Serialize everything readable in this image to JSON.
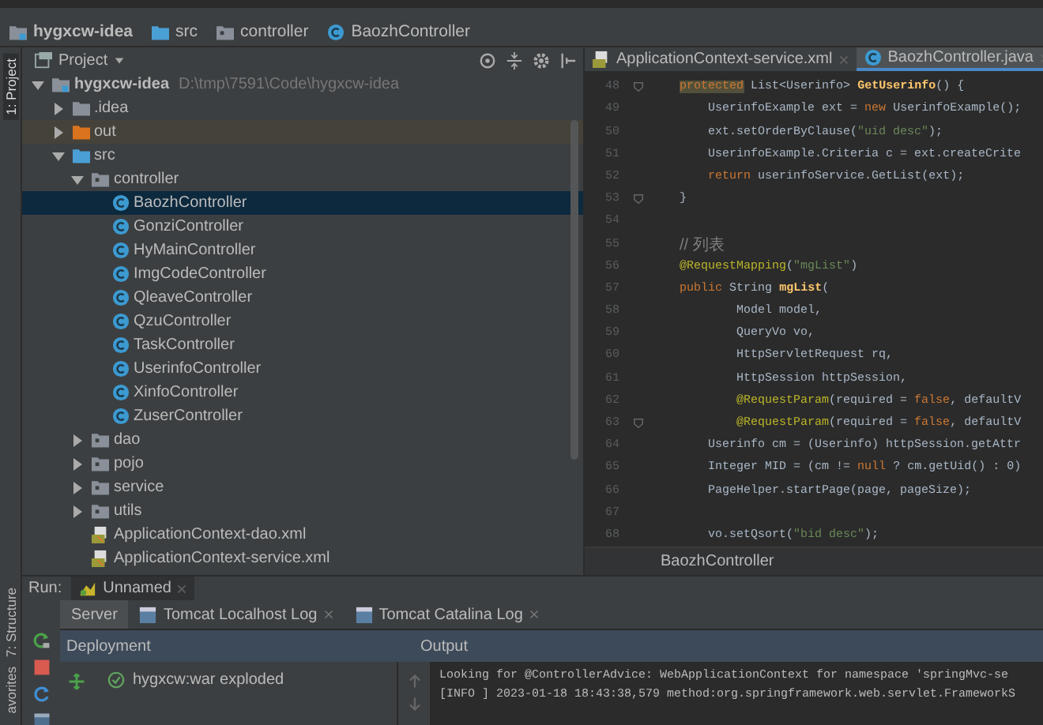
{
  "breadcrumbs": [
    {
      "label": "hygxcw-idea",
      "kind": "module"
    },
    {
      "label": "src",
      "kind": "folder"
    },
    {
      "label": "controller",
      "kind": "package"
    },
    {
      "label": "BaozhController",
      "kind": "class"
    }
  ],
  "tool_strip": {
    "top": [
      {
        "label": "1: Project",
        "selected": true
      }
    ],
    "bottom": [
      {
        "label": "7: Structure",
        "selected": false
      },
      {
        "label": "avorites",
        "selected": false
      }
    ]
  },
  "project": {
    "title": "Project",
    "tree": [
      {
        "label": "hygxcw-idea",
        "path": "D:\\tmp\\7591\\Code\\hygxcw-idea",
        "kind": "module",
        "expanded": true,
        "selected": false,
        "children": [
          {
            "label": ".idea",
            "kind": "folder",
            "expanded": false,
            "selected": false
          },
          {
            "label": "out",
            "kind": "excluded",
            "expanded": false,
            "selected": false
          },
          {
            "label": "src",
            "kind": "source",
            "expanded": true,
            "selected": false,
            "children": [
              {
                "label": "controller",
                "kind": "package",
                "expanded": true,
                "selected": false,
                "children": [
                  {
                    "label": "BaozhController",
                    "kind": "class",
                    "selected": true
                  },
                  {
                    "label": "GonziController",
                    "kind": "class",
                    "selected": false
                  },
                  {
                    "label": "HyMainController",
                    "kind": "class",
                    "selected": false
                  },
                  {
                    "label": "ImgCodeController",
                    "kind": "class",
                    "selected": false
                  },
                  {
                    "label": "QleaveController",
                    "kind": "class",
                    "selected": false
                  },
                  {
                    "label": "QzuController",
                    "kind": "class",
                    "selected": false
                  },
                  {
                    "label": "TaskController",
                    "kind": "class",
                    "selected": false
                  },
                  {
                    "label": "UserinfoController",
                    "kind": "class",
                    "selected": false
                  },
                  {
                    "label": "XinfoController",
                    "kind": "class",
                    "selected": false
                  },
                  {
                    "label": "ZuserController",
                    "kind": "class",
                    "selected": false
                  }
                ]
              },
              {
                "label": "dao",
                "kind": "package",
                "expanded": false,
                "selected": false
              },
              {
                "label": "pojo",
                "kind": "package",
                "expanded": false,
                "selected": false
              },
              {
                "label": "service",
                "kind": "package",
                "expanded": false,
                "selected": false
              },
              {
                "label": "utils",
                "kind": "package",
                "expanded": false,
                "selected": false
              },
              {
                "label": "ApplicationContext-dao.xml",
                "kind": "xml",
                "selected": false
              },
              {
                "label": "ApplicationContext-service.xml",
                "kind": "xml",
                "selected": false
              }
            ]
          }
        ]
      }
    ]
  },
  "editor": {
    "tabs": [
      {
        "label": "ApplicationContext-service.xml",
        "kind": "xml",
        "selected": false
      },
      {
        "label": "BaozhController.java",
        "kind": "class",
        "selected": true
      }
    ],
    "lines": [
      {
        "number": "48",
        "fold": true,
        "segments": [
          {
            "t": "    protected",
            "kind": "keyword-marked"
          },
          {
            "t": " List<Userinfo> "
          },
          {
            "t": "GetUserinfo",
            "kind": "method"
          },
          {
            "t": "() {"
          }
        ]
      },
      {
        "number": "49",
        "fold": false,
        "segments": [
          {
            "t": "        UserinfoExample ext = "
          },
          {
            "t": "new",
            "kind": "keyword"
          },
          {
            "t": " UserinfoExample();"
          }
        ]
      },
      {
        "number": "50",
        "fold": false,
        "segments": [
          {
            "t": "        ext.setOrderByClause("
          },
          {
            "t": "\"uid desc\"",
            "kind": "string"
          },
          {
            "t": ");"
          }
        ]
      },
      {
        "number": "51",
        "fold": false,
        "segments": [
          {
            "t": "        UserinfoExample.Criteria c = ext.createCrite"
          }
        ]
      },
      {
        "number": "52",
        "fold": false,
        "segments": [
          {
            "t": "        return",
            "kind": "keyword"
          },
          {
            "t": " userinfoService.GetList(ext);"
          }
        ]
      },
      {
        "number": "53",
        "fold": true,
        "segments": [
          {
            "t": "    }"
          }
        ]
      },
      {
        "number": "54",
        "fold": false
      },
      {
        "number": "55",
        "fold": false,
        "segments": [
          {
            "t": "    // 列表",
            "kind": "comment"
          }
        ]
      },
      {
        "number": "56",
        "fold": false,
        "segments": [
          {
            "t": "    @RequestMapping",
            "kind": "annotation"
          },
          {
            "t": "("
          },
          {
            "t": "\"mgList\"",
            "kind": "string"
          },
          {
            "t": ")"
          }
        ]
      },
      {
        "number": "57",
        "fold": false,
        "segments": [
          {
            "t": "    public",
            "kind": "keyword"
          },
          {
            "t": " String "
          },
          {
            "t": "mgList",
            "kind": "method"
          },
          {
            "t": "("
          }
        ]
      },
      {
        "number": "58",
        "fold": false,
        "segments": [
          {
            "t": "            Model model,"
          }
        ]
      },
      {
        "number": "59",
        "fold": false,
        "segments": [
          {
            "t": "            QueryVo vo,"
          }
        ]
      },
      {
        "number": "60",
        "fold": false,
        "segments": [
          {
            "t": "            HttpServletRequest rq,"
          }
        ]
      },
      {
        "number": "61",
        "fold": false,
        "segments": [
          {
            "t": "            HttpSession httpSession,"
          }
        ]
      },
      {
        "number": "62",
        "fold": false,
        "segments": [
          {
            "t": "            @RequestParam",
            "kind": "annotation"
          },
          {
            "t": "(required = "
          },
          {
            "t": "false",
            "kind": "keyword"
          },
          {
            "t": ", defaultV"
          }
        ]
      },
      {
        "number": "63",
        "fold": true,
        "segments": [
          {
            "t": "            @RequestParam",
            "kind": "annotation"
          },
          {
            "t": "(required = "
          },
          {
            "t": "false",
            "kind": "keyword"
          },
          {
            "t": ", defaultV"
          }
        ]
      },
      {
        "number": "64",
        "fold": false,
        "segments": [
          {
            "t": "        Userinfo cm = (Userinfo) httpSession.getAttr"
          }
        ]
      },
      {
        "number": "65",
        "fold": false,
        "segments": [
          {
            "t": "        Integer MID = (cm != "
          },
          {
            "t": "null",
            "kind": "keyword"
          },
          {
            "t": " ? cm.getUid() : 0)"
          }
        ]
      },
      {
        "number": "66",
        "fold": false,
        "segments": [
          {
            "t": "        PageHelper.startPage(page, pageSize);"
          }
        ]
      },
      {
        "number": "67",
        "fold": false
      },
      {
        "number": "68",
        "fold": false,
        "segments": [
          {
            "t": "        vo.setQsort("
          },
          {
            "t": "\"bid desc\"",
            "kind": "string"
          },
          {
            "t": ");"
          }
        ]
      }
    ],
    "breadcrumb": "BaozhController"
  },
  "run": {
    "label": "Run:",
    "config": "Unnamed",
    "tabs": [
      {
        "label": "Server",
        "selected": true,
        "closable": false
      },
      {
        "label": "Tomcat Localhost Log",
        "selected": false,
        "closable": true
      },
      {
        "label": "Tomcat Catalina Log",
        "selected": false,
        "closable": true
      }
    ],
    "columns": [
      "Deployment",
      "Output"
    ],
    "deployments": [
      {
        "name": "hygxcw:war exploded",
        "deployed": true
      }
    ],
    "output": [
      "Looking for @ControllerAdvice: WebApplicationContext for namespace 'springMvc-se",
      "[INFO ] 2023-01-18 18:43:38,579 method:org.springframework.web.servlet.FrameworkS"
    ]
  }
}
